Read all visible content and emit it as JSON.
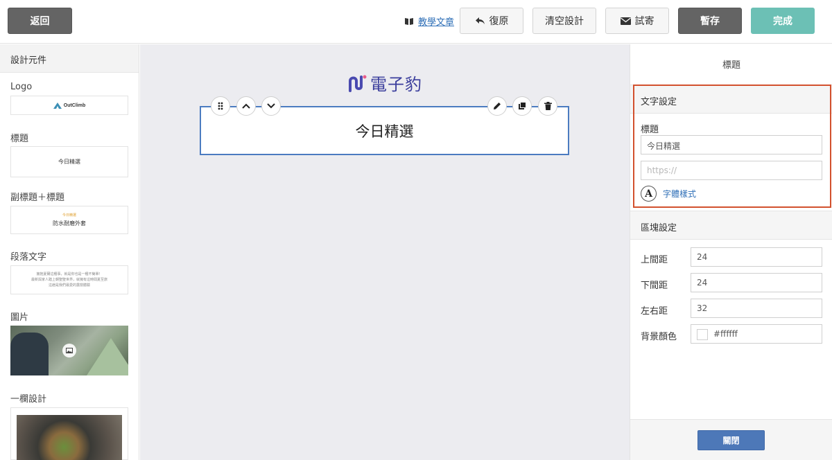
{
  "topbar": {
    "back_label": "返回",
    "tutorial_label": "教學文章",
    "undo_label": "復原",
    "clear_label": "清空設計",
    "test_send_label": "試寄",
    "save_label": "暫存",
    "done_label": "完成"
  },
  "left_panel": {
    "header": "設計元件",
    "components": [
      {
        "label": "Logo",
        "preview": "OutClimb"
      },
      {
        "label": "標題",
        "preview": "今日精選"
      },
      {
        "label": "副標題＋標題",
        "preview_sub": "今日精選",
        "preview_title": "防水耐磨外套"
      },
      {
        "label": "段落文字",
        "preview_lines": [
          "擁抱夏爾這種事，就是你也是一種不簡單！",
          "最新與家人踏上朝聖聖世界，就擁有這時間夏至旅",
          "這趟是我們最愛的露營體驗"
        ]
      },
      {
        "label": "圖片"
      },
      {
        "label": "一欄設計"
      }
    ]
  },
  "canvas": {
    "brand_name": "電子豹",
    "block_title": "今日精選"
  },
  "right_panel": {
    "title": "標題",
    "text_settings": {
      "header": "文字設定",
      "field_label": "標題",
      "title_value": "今日精選",
      "url_placeholder": "https://",
      "font_style_label": "字體樣式",
      "font_icon_letter": "A"
    },
    "block_settings": {
      "header": "區塊設定",
      "padding_top_label": "上間距",
      "padding_top": "24",
      "padding_bottom_label": "下間距",
      "padding_bottom": "24",
      "padding_side_label": "左右距",
      "padding_side": "32",
      "bg_color_label": "背景顏色",
      "bg_color": "#ffffff"
    },
    "close_label": "關閉"
  },
  "colors": {
    "accent_teal": "#6cc0b5",
    "dark_button": "#646464",
    "link_blue": "#2f6fb7",
    "selection_blue": "#4b7bc0",
    "highlight_red": "#d2502d",
    "brand_purple": "#3a3d9c"
  }
}
